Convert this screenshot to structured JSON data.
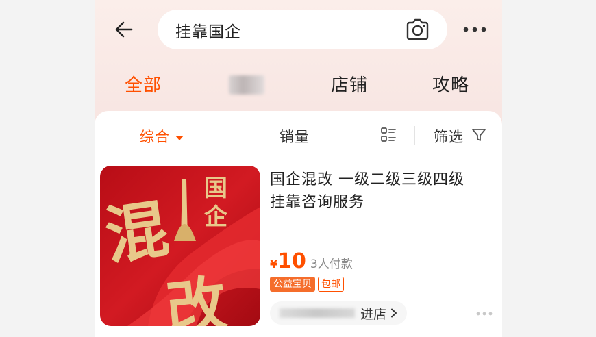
{
  "search": {
    "query": "挂靠国企"
  },
  "tabs": [
    {
      "label": "全部",
      "active": true
    },
    {
      "label": "店铺",
      "active": false
    },
    {
      "label": "攻略",
      "active": false
    }
  ],
  "sort": {
    "comprehensive": "综合",
    "sales": "销量",
    "filter": "筛选"
  },
  "product": {
    "title": "国企混改  一级二级三级四级\n挂靠咨询服务",
    "currency": "¥",
    "price": "10",
    "sold": "3人付款",
    "badge_charity": "公益宝贝",
    "badge_free_shipping": "包邮",
    "enter_shop": "进店",
    "thumb_text": {
      "top1": "国",
      "top2": "企",
      "big1": "混",
      "big2": "改"
    }
  },
  "colors": {
    "accent": "#ff5000",
    "badge": "#f56d2b",
    "thumb_red": "#c8101a",
    "thumb_gold": "#e8c88a"
  },
  "icons": [
    "back-icon",
    "camera-icon",
    "more-icon",
    "caret-down-icon",
    "list-view-icon",
    "filter-icon",
    "chevron-right-icon",
    "more-dots-icon"
  ]
}
